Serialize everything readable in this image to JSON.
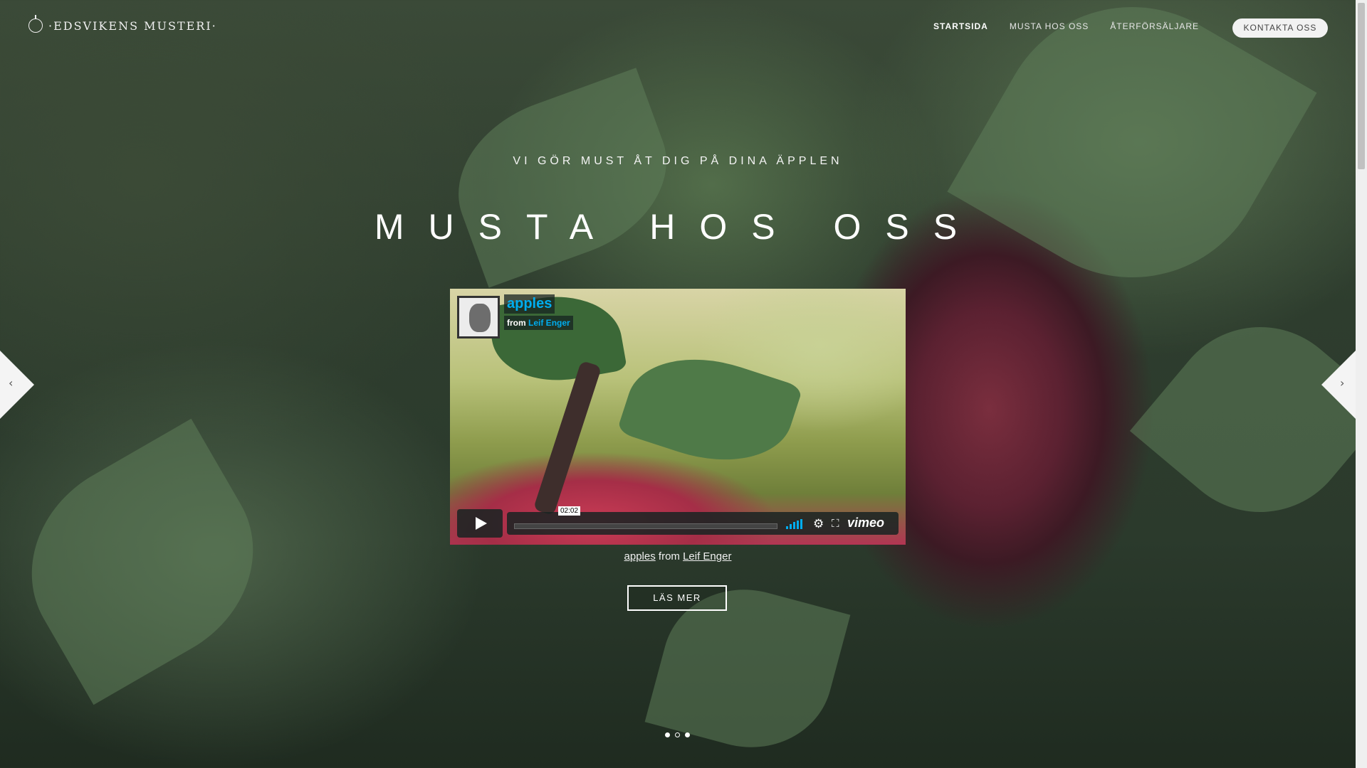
{
  "brand": {
    "name": "·EDSVIKENS MUSTERI·",
    "logo_icon": "apple-icon"
  },
  "nav": {
    "items": [
      {
        "label": "STARTSIDA",
        "active": true
      },
      {
        "label": "MUSTA HOS OSS",
        "active": false
      },
      {
        "label": "ÅTERFÖRSÄLJARE",
        "active": false
      }
    ],
    "contact_label": "KONTAKTA OSS"
  },
  "hero": {
    "subtitle": "VI GÖR MUST ÅT DIG PÅ DINA ÄPPLEN",
    "heading": "MUSTA HOS OSS",
    "read_more": "LÄS MER"
  },
  "video": {
    "title": "apples",
    "from_prefix": "from",
    "author": "Leif Enger",
    "timecode": "02:02",
    "provider": "vimeo",
    "accent_color": "#00adef"
  },
  "caption": {
    "title_link": "apples",
    "middle": "from",
    "author_link": "Leif Enger"
  },
  "slider": {
    "prev_icon": "‹",
    "next_icon": "›",
    "dot_count": 3,
    "active_dot": 2
  }
}
